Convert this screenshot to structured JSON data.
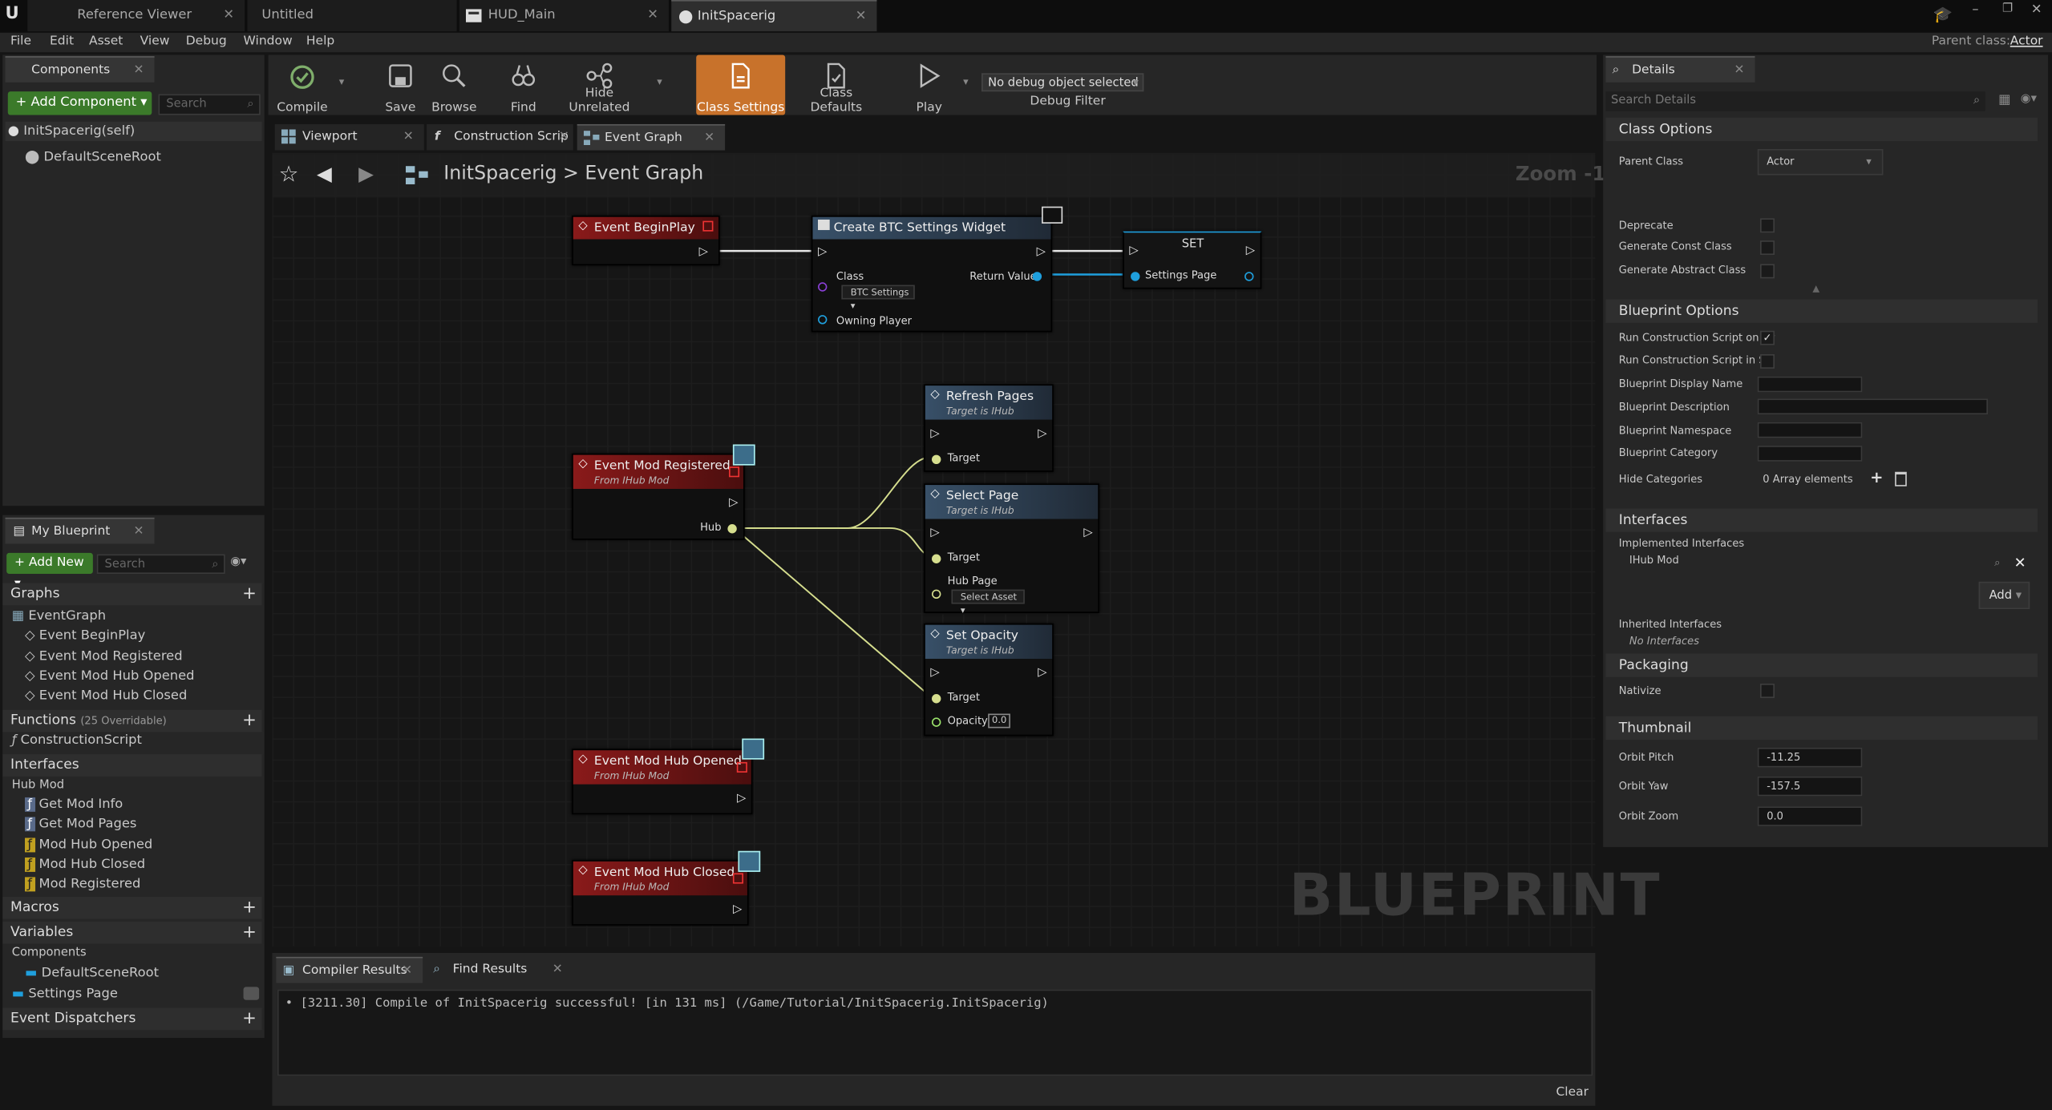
{
  "tabs": [
    {
      "label": "Reference Viewer"
    },
    {
      "label": "Untitled"
    },
    {
      "label": "HUD_Main"
    },
    {
      "label": "InitSpacerig"
    }
  ],
  "parent_class": {
    "label": "Parent class:",
    "value": "Actor"
  },
  "menu": [
    "File",
    "Edit",
    "Asset",
    "View",
    "Debug",
    "Window",
    "Help"
  ],
  "components_panel": {
    "title": "Components",
    "add_label": "Add Component",
    "search_placeholder": "Search",
    "items": [
      "InitSpacerig(self)",
      "DefaultSceneRoot"
    ]
  },
  "toolbar": {
    "compile": "Compile",
    "save": "Save",
    "browse": "Browse",
    "find": "Find",
    "hide_unrelated": "Hide Unrelated",
    "class_settings": "Class Settings",
    "class_defaults": "Class Defaults",
    "play": "Play",
    "debug_object": "No debug object selected",
    "debug_filter": "Debug Filter"
  },
  "editor_tabs": [
    "Viewport",
    "Construction Scrip",
    "Event Graph"
  ],
  "graph": {
    "breadcrumb_root": "InitSpacerig",
    "breadcrumb_sep": ">",
    "breadcrumb_current": "Event Graph",
    "zoom": "Zoom -1",
    "watermark": "BLUEPRINT",
    "nodes": {
      "begin_play": {
        "title": "Event BeginPlay"
      },
      "create_widget": {
        "title": "Create BTC Settings Widget",
        "class_label": "Class",
        "class_value": "BTC Settings",
        "return_label": "Return Value",
        "owning_label": "Owning Player"
      },
      "set": {
        "title": "SET",
        "pin": "Settings Page"
      },
      "mod_registered": {
        "title": "Event Mod Registered",
        "subtitle": "From IHub Mod",
        "hub_label": "Hub"
      },
      "refresh_pages": {
        "title": "Refresh Pages",
        "subtitle": "Target is IHub",
        "target": "Target"
      },
      "select_page": {
        "title": "Select Page",
        "subtitle": "Target is IHub",
        "target": "Target",
        "hub_page": "Hub Page",
        "select_asset": "Select Asset"
      },
      "set_opacity": {
        "title": "Set Opacity",
        "subtitle": "Target is IHub",
        "target": "Target",
        "opacity_label": "Opacity",
        "opacity_value": "0.0"
      },
      "hub_opened": {
        "title": "Event Mod Hub Opened",
        "subtitle": "From IHub Mod"
      },
      "hub_closed": {
        "title": "Event Mod Hub Closed",
        "subtitle": "From IHub Mod"
      }
    }
  },
  "my_blueprint": {
    "title": "My Blueprint",
    "add_label": "Add New",
    "search_placeholder": "Search",
    "graphs_label": "Graphs",
    "graphs": [
      "EventGraph",
      "Event BeginPlay",
      "Event Mod Registered",
      "Event Mod Hub Opened",
      "Event Mod Hub Closed"
    ],
    "functions_label": "Functions",
    "functions_count": "(25 Overridable)",
    "functions": [
      "ConstructionScript"
    ],
    "interfaces_label": "Interfaces",
    "hub_mod_label": "Hub Mod",
    "interfaces": [
      "Get Mod Info",
      "Get Mod Pages",
      "Mod Hub Opened",
      "Mod Hub Closed",
      "Mod Registered"
    ],
    "macros_label": "Macros",
    "variables_label": "Variables",
    "components_label": "Components",
    "variables": [
      "DefaultSceneRoot",
      "Settings Page"
    ],
    "dispatchers_label": "Event Dispatchers"
  },
  "bottom": {
    "tabs": [
      "Compiler Results",
      "Find Results"
    ],
    "log": "[3211.30] Compile of InitSpacerig successful! [in 131 ms] (/Game/Tutorial/InitSpacerig.InitSpacerig)",
    "clear": "Clear"
  },
  "details": {
    "title": "Details",
    "search_placeholder": "Search Details",
    "class_options": "Class Options",
    "parent_class_label": "Parent Class",
    "parent_class_value": "Actor",
    "deprecate": "Deprecate",
    "gen_const": "Generate Const Class",
    "gen_abstract": "Generate Abstract Class",
    "blueprint_options": "Blueprint Options",
    "run_cs_drag": "Run Construction Script on Dr",
    "run_cs_seq": "Run Construction Script in Se",
    "bp_display_name": "Blueprint Display Name",
    "bp_description": "Blueprint Description",
    "bp_namespace": "Blueprint Namespace",
    "bp_category": "Blueprint Category",
    "hide_categories": "Hide Categories",
    "array_elements": "0 Array elements",
    "interfaces": "Interfaces",
    "implemented": "Implemented Interfaces",
    "ihub_mod": "IHub Mod",
    "add": "Add",
    "inherited": "Inherited Interfaces",
    "no_interfaces": "No Interfaces",
    "packaging": "Packaging",
    "nativize": "Nativize",
    "thumbnail": "Thumbnail",
    "orbit_pitch": "Orbit Pitch",
    "orbit_pitch_value": "-11.25",
    "orbit_yaw": "Orbit Yaw",
    "orbit_yaw_value": "-157.5",
    "orbit_zoom": "Orbit Zoom",
    "orbit_zoom_value": "0.0"
  },
  "colors": {
    "accent": "#c8722b",
    "event_header": "#7a1515",
    "function_header": "#2c3e52",
    "exec": "#e0e0e0",
    "object_pin": "#1f9fdd",
    "wire_interface": "#d6de8e"
  }
}
